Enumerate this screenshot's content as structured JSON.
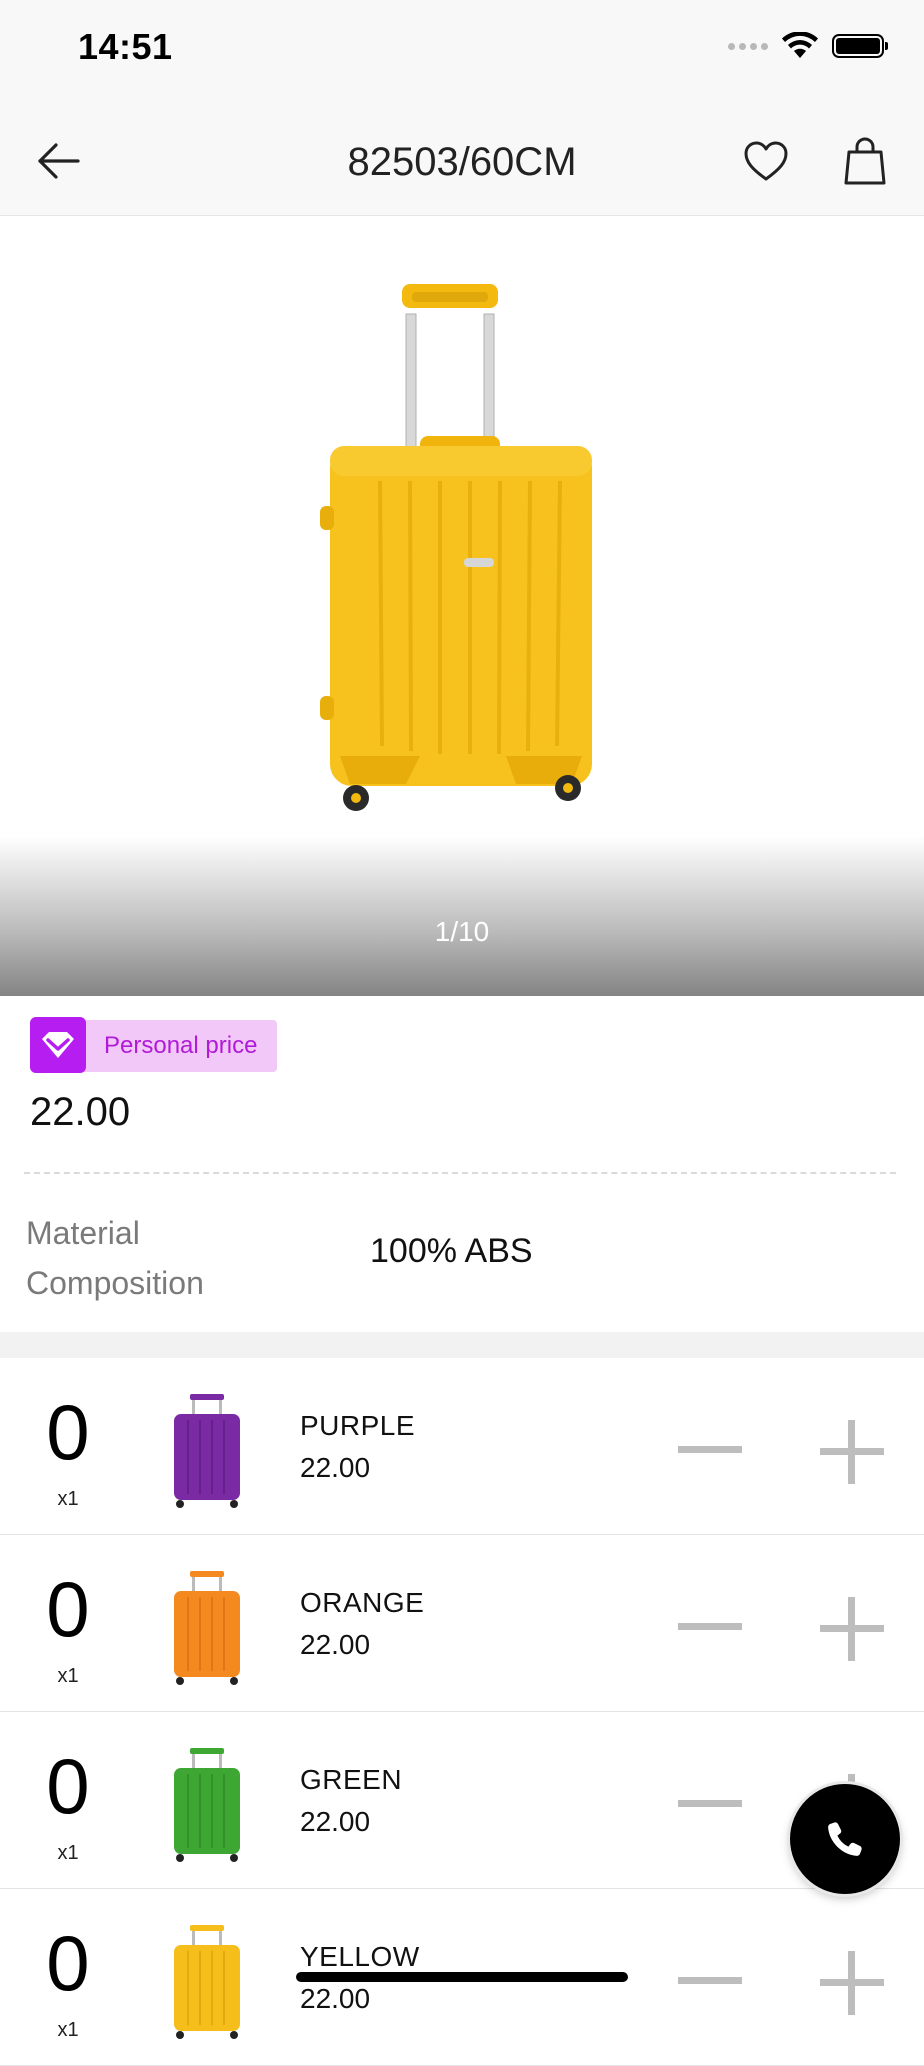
{
  "status_bar": {
    "time": "14:51"
  },
  "nav": {
    "title": "82503/60CM",
    "icons": [
      "arrow-left-icon",
      "heart-icon",
      "shopping-bag-icon"
    ]
  },
  "gallery": {
    "counter": "1/10",
    "current_color": "#f5be1b"
  },
  "price": {
    "badge_label": "Personal price",
    "value": "22.00",
    "badge_color": "#b61df0"
  },
  "material": {
    "label": "Material Composition",
    "value": "100% ABS"
  },
  "variants": [
    {
      "qty": "0",
      "multiplier": "x1",
      "name": "PURPLE",
      "price": "22.00",
      "color": "#7a2aa3"
    },
    {
      "qty": "0",
      "multiplier": "x1",
      "name": "ORANGE",
      "price": "22.00",
      "color": "#f48a1f"
    },
    {
      "qty": "0",
      "multiplier": "x1",
      "name": "GREEN",
      "price": "22.00",
      "color": "#3ea632"
    },
    {
      "qty": "0",
      "multiplier": "x1",
      "name": "YELLOW",
      "price": "22.00",
      "color": "#f5be1b"
    }
  ]
}
